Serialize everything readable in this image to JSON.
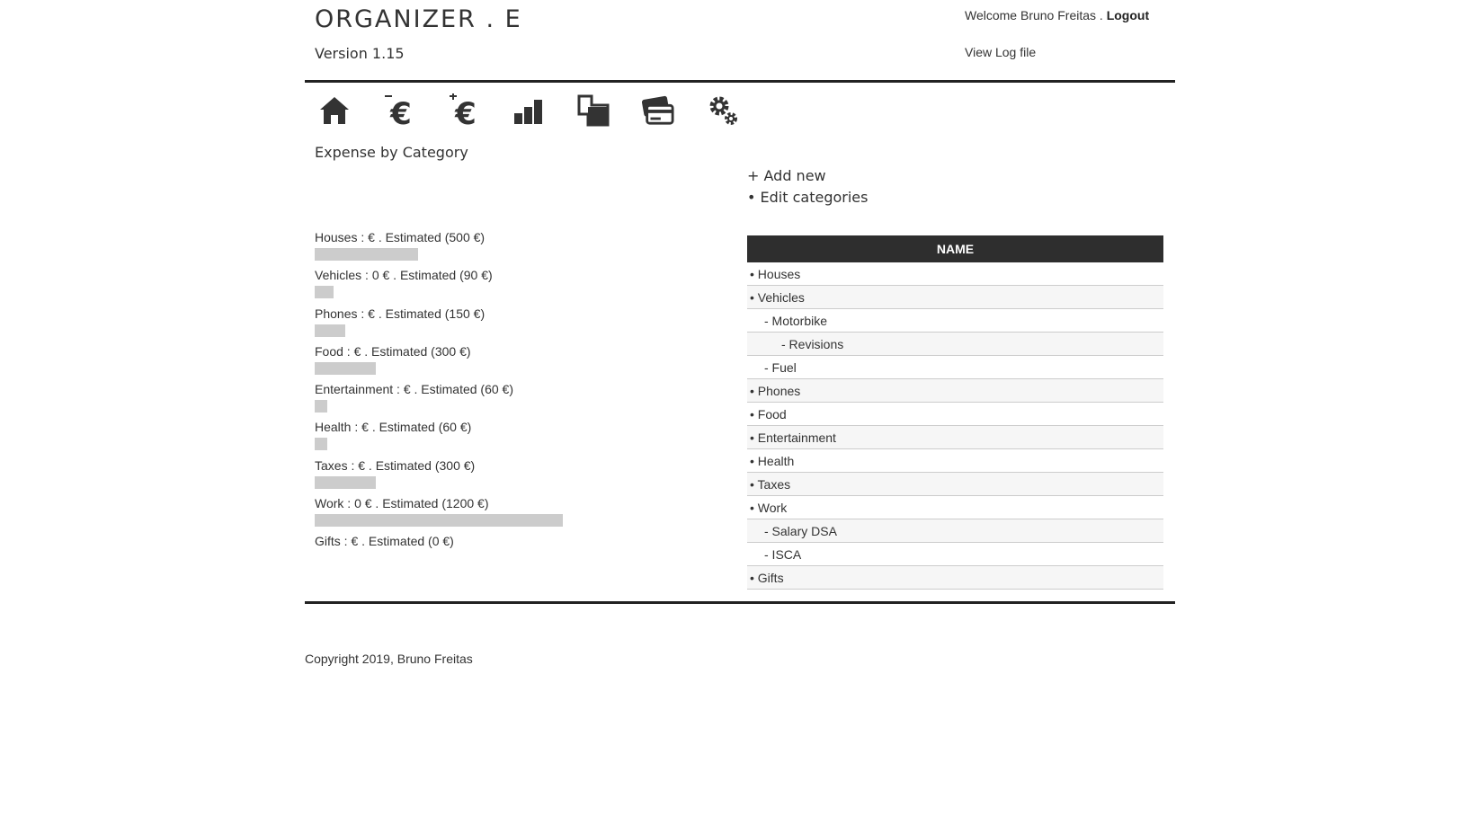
{
  "header": {
    "brand": "ORGANIZER . E",
    "version": "Version 1.15",
    "welcome_text": "Welcome Bruno Freitas . ",
    "logout_label": "Logout",
    "view_log_label": "View Log file"
  },
  "nav": [
    {
      "name": "home-icon"
    },
    {
      "name": "expense-euro-icon"
    },
    {
      "name": "income-euro-icon"
    },
    {
      "name": "bar-chart-icon"
    },
    {
      "name": "documents-icon"
    },
    {
      "name": "credit-card-icon"
    },
    {
      "name": "settings-gears-icon"
    }
  ],
  "page_title": "Expense by Category",
  "actions": {
    "add_new": "+ Add new",
    "edit_categories": "• Edit categories"
  },
  "expenses": [
    {
      "label": "Houses : €  .  Estimated (500 €)",
      "bar_width": 115
    },
    {
      "label": "Vehicles : 0 €  .  Estimated (90 €)",
      "bar_width": 21
    },
    {
      "label": "Phones : €  .  Estimated (150 €)",
      "bar_width": 34
    },
    {
      "label": "Food : €  .  Estimated (300 €)",
      "bar_width": 68
    },
    {
      "label": "Entertainment : €  .  Estimated (60 €)",
      "bar_width": 14
    },
    {
      "label": "Health : €  .  Estimated (60 €)",
      "bar_width": 14
    },
    {
      "label": "Taxes : €  .  Estimated (300 €)",
      "bar_width": 68
    },
    {
      "label": "Work : 0 €  .  Estimated (1200 €)",
      "bar_width": 276
    },
    {
      "label": "Gifts : €  .  Estimated (0 €)",
      "bar_width": 0
    }
  ],
  "table": {
    "header": "NAME",
    "rows": [
      {
        "label": "• Houses",
        "level": 0
      },
      {
        "label": "• Vehicles",
        "level": 0
      },
      {
        "label": "- Motorbike",
        "level": 1
      },
      {
        "label": "- Revisions",
        "level": 2
      },
      {
        "label": "- Fuel",
        "level": 1
      },
      {
        "label": "• Phones",
        "level": 0
      },
      {
        "label": "• Food",
        "level": 0
      },
      {
        "label": "• Entertainment",
        "level": 0
      },
      {
        "label": "• Health",
        "level": 0
      },
      {
        "label": "• Taxes",
        "level": 0
      },
      {
        "label": "• Work",
        "level": 0
      },
      {
        "label": "- Salary DSA",
        "level": 1
      },
      {
        "label": "- ISCA",
        "level": 1
      },
      {
        "label": "• Gifts",
        "level": 0
      }
    ]
  },
  "footer": {
    "copyright": "Copyright 2019, Bruno Freitas"
  }
}
